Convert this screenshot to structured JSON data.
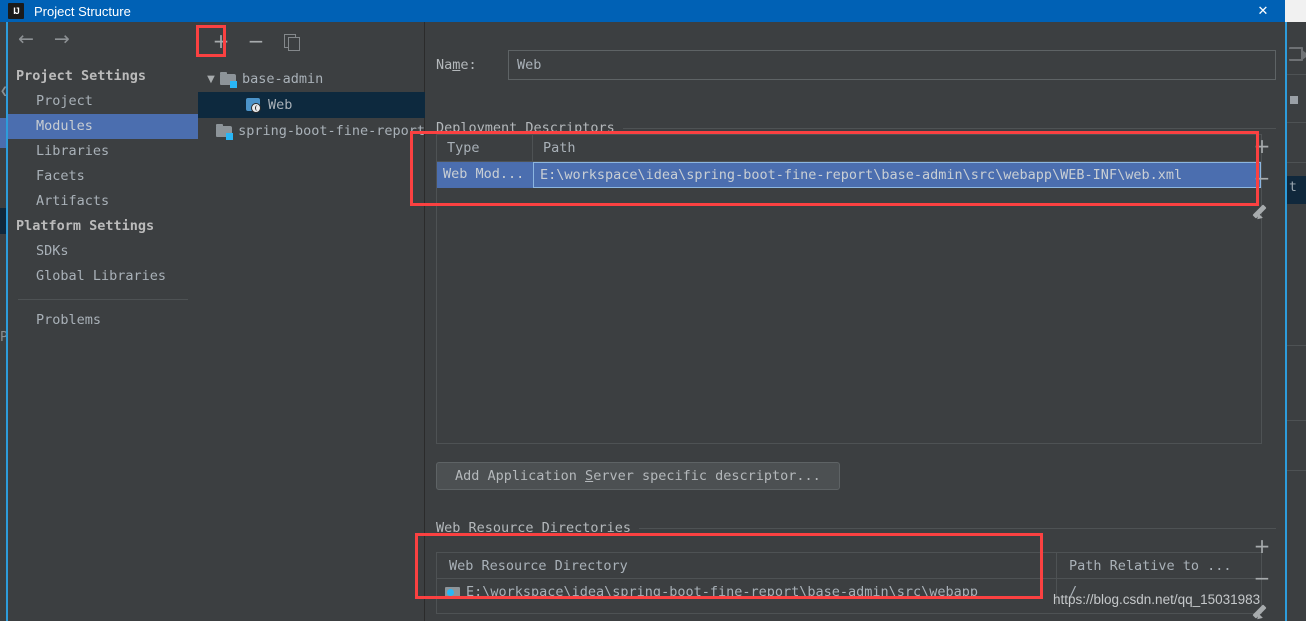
{
  "window": {
    "title": "Project Structure",
    "app_icon": "intellij-idea-icon",
    "close_label": "✕"
  },
  "sidebar": {
    "back_icon": "←",
    "forward_icon": "→",
    "groups": [
      {
        "label": "Project Settings",
        "items": [
          {
            "label": "Project",
            "selected": false
          },
          {
            "label": "Modules",
            "selected": true
          },
          {
            "label": "Libraries",
            "selected": false
          },
          {
            "label": "Facets",
            "selected": false
          },
          {
            "label": "Artifacts",
            "selected": false
          }
        ]
      },
      {
        "label": "Platform Settings",
        "items": [
          {
            "label": "SDKs",
            "selected": false
          },
          {
            "label": "Global Libraries",
            "selected": false
          }
        ]
      }
    ],
    "problems_label": "Problems"
  },
  "tree": {
    "toolbar": {
      "add_label": "+",
      "remove_label": "−",
      "copy_label": "copy-icon"
    },
    "nodes": [
      {
        "label": "base-admin",
        "icon": "folder-module-icon",
        "indent": 0,
        "expanded": true,
        "selected": false,
        "twisty": "▼"
      },
      {
        "label": "Web",
        "icon": "web-facet-icon",
        "indent": 1,
        "expanded": false,
        "selected": true,
        "twisty": ""
      },
      {
        "label": "spring-boot-fine-report",
        "icon": "folder-module-icon",
        "indent": 0,
        "expanded": false,
        "selected": false,
        "twisty": ""
      }
    ]
  },
  "main": {
    "name_label_pre": "Na",
    "name_label_mnemonic": "m",
    "name_label_post": "e:",
    "name_value": "Web",
    "name_placeholder": "",
    "deployment_descriptors": {
      "section_title": "Deployment Descriptors",
      "columns": [
        "Type",
        "Path"
      ],
      "rows": [
        {
          "type": "Web Mod...",
          "path": "E:\\workspace\\idea\\spring-boot-fine-report\\base-admin\\src\\webapp\\WEB-INF\\web.xml",
          "selected": true
        }
      ],
      "add_label": "+",
      "remove_label": "−",
      "edit_label": "edit-pencil-icon"
    },
    "add_descriptor_button": {
      "pre": "Add Application ",
      "mnemonic": "S",
      "post": "erver specific descriptor..."
    },
    "web_resource_directories": {
      "section_title": "Web Resource Directories",
      "columns": [
        "Web Resource Directory",
        "Path Relative to ..."
      ],
      "rows": [
        {
          "directory": "E:\\workspace\\idea\\spring-boot-fine-report\\base-admin\\src\\webapp",
          "relative": "/"
        }
      ],
      "add_label": "+",
      "remove_label": "−",
      "edit_label": "edit-pencil-icon"
    }
  },
  "watermark": "https://blog.csdn.net/qq_15031983",
  "colors": {
    "titlebar": "#0061b5",
    "panel_bg": "#3c3f41",
    "selection_blue": "#4b6eaf",
    "tree_selection": "#0d293e",
    "annotation_red": "#fb4141",
    "accent_cyan": "#29b6f6"
  }
}
